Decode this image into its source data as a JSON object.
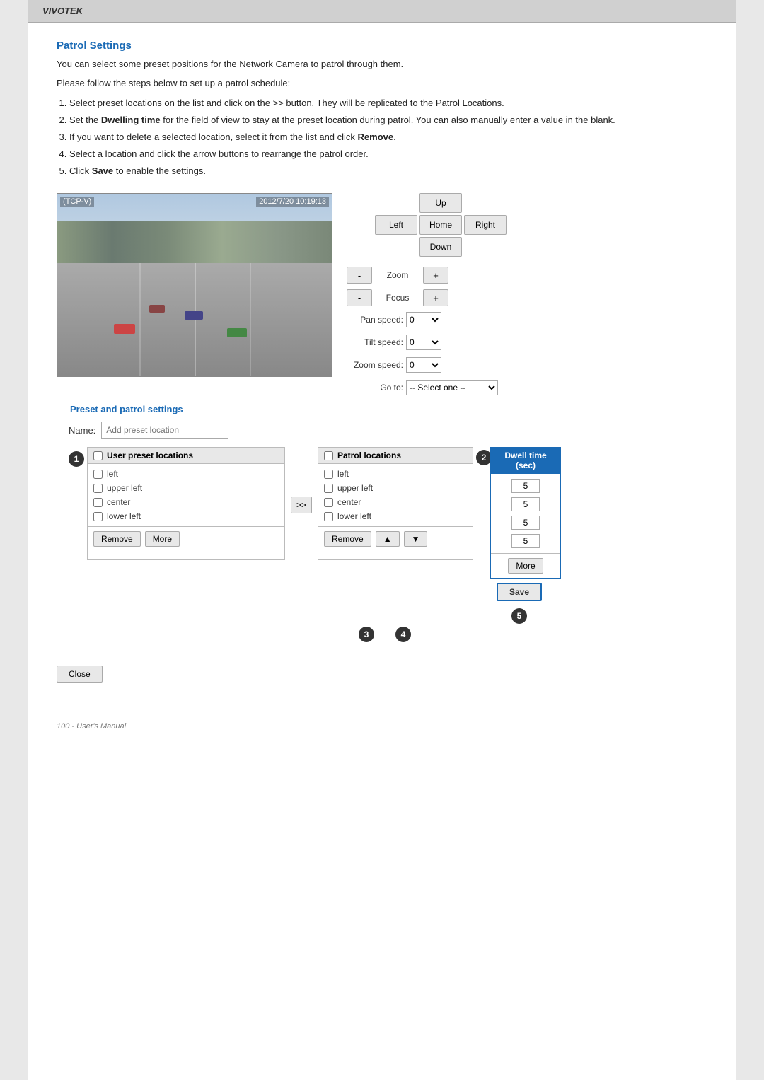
{
  "brand": "VIVOTEK",
  "section_title": "Patrol Settings",
  "description1": "You can select some preset positions for the Network Camera to patrol through them.",
  "description2": "Please follow the steps below to set up a patrol schedule:",
  "steps": [
    "Select preset locations on the list and click on the >> button. They will be replicated to the Patrol Locations.",
    "Set the Dwelling time for the field of view to stay at the preset location during patrol. You can also manually enter a value in the blank.",
    "If you want to delete a selected location, select it from the list and click Remove.",
    "Select a location and click the arrow buttons to rearrange the patrol order.",
    "Click Save to enable the settings."
  ],
  "camera": {
    "label": "(TCP-V)",
    "timestamp": "2012/7/20 10:19:13"
  },
  "ptz": {
    "up_label": "Up",
    "down_label": "Down",
    "left_label": "Left",
    "home_label": "Home",
    "right_label": "Right",
    "zoom_label": "Zoom",
    "focus_label": "Focus",
    "zoom_minus": "-",
    "zoom_plus": "+",
    "focus_minus": "-",
    "focus_plus": "+",
    "pan_speed_label": "Pan speed:",
    "tilt_speed_label": "Tilt speed:",
    "zoom_speed_label": "Zoom speed:",
    "goto_label": "Go to:",
    "goto_placeholder": "-- Select one --",
    "pan_speed_value": "0",
    "tilt_speed_value": "0",
    "zoom_speed_value": "0"
  },
  "preset_box": {
    "legend": "Preset and patrol settings",
    "name_label": "Name:",
    "name_placeholder": "Add preset location"
  },
  "user_preset": {
    "header": "User preset locations",
    "items": [
      "left",
      "upper left",
      "center",
      "lower left"
    ]
  },
  "patrol_locations": {
    "header": "Patrol locations",
    "items": [
      "left",
      "upper left",
      "center",
      "lower left"
    ]
  },
  "dwell_time": {
    "header_line1": "Dwell time",
    "header_line2": "(sec)",
    "values": [
      "5",
      "5",
      "5",
      "5"
    ]
  },
  "buttons": {
    "remove_label": "Remove",
    "more_label": "More",
    "arrow_up": "▲",
    "arrow_down": "▼",
    "transfer_label": ">>",
    "save_label": "Save",
    "close_label": "Close"
  },
  "step_numbers": [
    "1",
    "2",
    "3",
    "4",
    "5"
  ],
  "footer": "100 - User's Manual"
}
